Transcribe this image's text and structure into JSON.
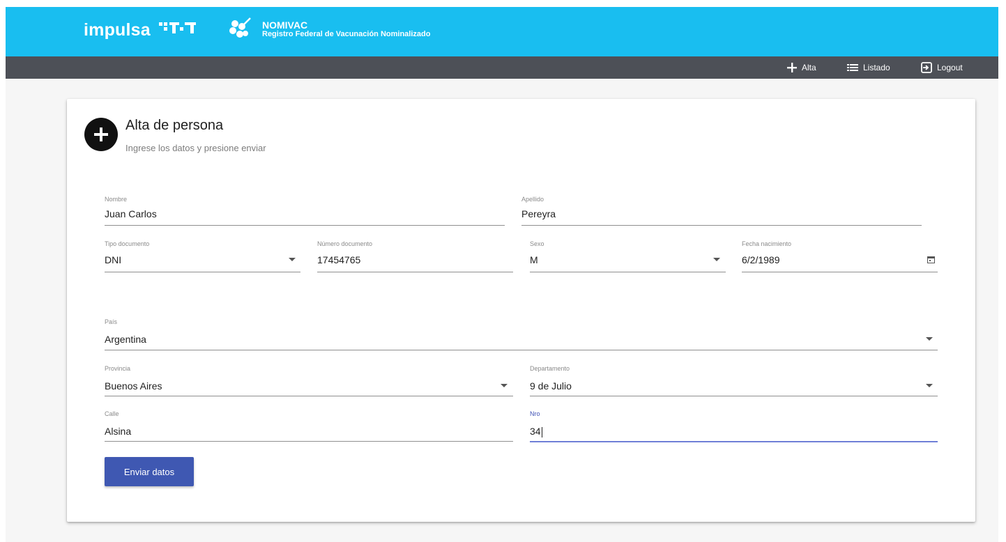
{
  "header": {
    "brand": "impulsa",
    "app_name": "NOMIVAC",
    "app_subtitle": "Registro Federal de Vacunación Nominalizado",
    "bar_color": "#19bef0"
  },
  "nav": {
    "alta": "Alta",
    "listado": "Listado",
    "logout": "Logout"
  },
  "card": {
    "title": "Alta de persona",
    "subtitle": "Ingrese los datos y presione enviar"
  },
  "form": {
    "nombre": {
      "label": "Nombre",
      "value": "Juan Carlos"
    },
    "apellido": {
      "label": "Apellido",
      "value": "Pereyra"
    },
    "tipo_documento": {
      "label": "Tipo documento",
      "value": "DNI"
    },
    "numero_documento": {
      "label": "Número documento",
      "value": "17454765"
    },
    "sexo": {
      "label": "Sexo",
      "value": "M"
    },
    "fecha_nacimiento": {
      "label": "Fecha nacimiento",
      "value": "6/2/1989"
    },
    "pais": {
      "label": "País",
      "value": "Argentina"
    },
    "provincia": {
      "label": "Provincia",
      "value": "Buenos Aires"
    },
    "departamento": {
      "label": "Departamento",
      "value": "9 de Julio"
    },
    "calle": {
      "label": "Calle",
      "value": "Alsina"
    },
    "nro": {
      "label": "Nro",
      "value": "34"
    },
    "submit_label": "Enviar datos",
    "accent_color": "#3f58b2"
  }
}
